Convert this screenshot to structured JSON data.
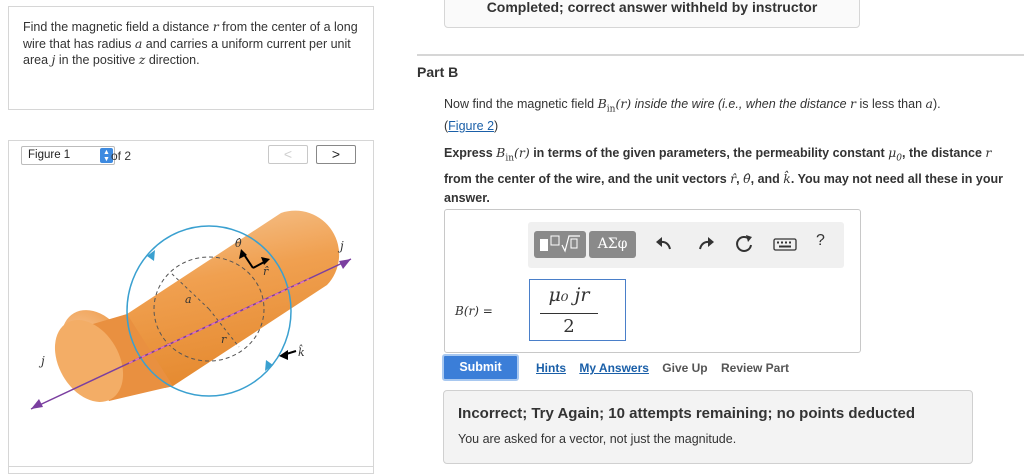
{
  "problem": {
    "text_1": "Find the magnetic field a distance ",
    "var_r": "r",
    "text_2": " from the center of a long wire that has radius ",
    "var_a": "a",
    "text_3": " and carries a uniform current per unit area ",
    "var_j": "j",
    "text_4": " in the positive ",
    "var_z": "z",
    "text_5": " direction."
  },
  "figure": {
    "select_value": "Figure 1",
    "of_text": "of 2",
    "prev_label": "<",
    "next_label": ">",
    "labels": {
      "theta": "θ̂",
      "r_hat": "r̂",
      "j_top": "j",
      "j_bottom": "j",
      "a": "a",
      "r": "r",
      "k_hat": "k̂"
    }
  },
  "status": {
    "banner": "Completed; correct answer withheld by instructor"
  },
  "part": {
    "label": "Part B",
    "question_1": "Now find the magnetic field ",
    "B": "B",
    "sub_in": "in",
    "arg": "(r)",
    "question_2": " inside the wire (i.e., when the distance ",
    "var_r": "r",
    "question_3": " is less than ",
    "var_a": "a",
    "question_4": ").",
    "figure_link": "Figure 2",
    "instr_1": "Express ",
    "instr_2": " in terms of the given parameters, the permeability constant ",
    "mu0": "μ",
    "mu0_sub": "0",
    "instr_3": ", the distance ",
    "instr_4": " from the center of the wire, and the unit vectors ",
    "unit_r": "r̂",
    "unit_theta": "θ̂",
    "unit_k": "k̂",
    "instr_5": ", and ",
    "instr_6": ". You may not need all these in your answer.",
    "comma": ", "
  },
  "answer": {
    "toolbar_greek": "ΑΣφ",
    "help_label": "?",
    "lhs": "B(r) =",
    "numerator": "μ₀ jr",
    "denominator": "2"
  },
  "buttons": {
    "submit": "Submit",
    "hints": "Hints",
    "my_answers": "My Answers",
    "give_up": "Give Up",
    "review_part": "Review Part"
  },
  "feedback": {
    "title": "Incorrect; Try Again; 10 attempts remaining; no points deducted",
    "message": "You are asked for a vector, not just the magnitude."
  },
  "colors": {
    "cylinder": "#f0a050",
    "circle": "#3aa0d0",
    "axis": "#7b3fa0",
    "submit": "#3b7ed8",
    "link": "#1a5fa8"
  }
}
